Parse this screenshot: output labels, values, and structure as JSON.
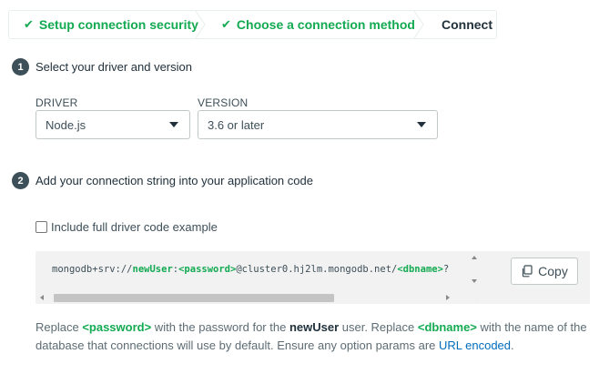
{
  "stepper": {
    "steps": [
      {
        "label": "Setup connection security",
        "state": "done"
      },
      {
        "label": "Choose a connection method",
        "state": "done"
      },
      {
        "label": "Connect",
        "state": "current"
      }
    ]
  },
  "section1": {
    "number": "1",
    "title": "Select your driver and version",
    "driver_label": "DRIVER",
    "driver_value": "Node.js",
    "version_label": "VERSION",
    "version_value": "3.6 or later"
  },
  "section2": {
    "number": "2",
    "title": "Add your connection string into your application code",
    "checkbox_label": "Include full driver code example",
    "connection_string": {
      "prefix": "mongodb+srv://",
      "user": "newUser",
      "colon": ":",
      "password": "<password>",
      "host": "@cluster0.hj2lm.mongodb.net/",
      "dbname": "<dbname>",
      "suffix": "?"
    },
    "copy_label": "Copy"
  },
  "help": {
    "t1": "Replace ",
    "password": "<password>",
    "t2": " with the password for the ",
    "user": "newUser",
    "t3": " user. Replace ",
    "dbname": "<dbname>",
    "t4": " with the name of the database that connections will use by default. Ensure any option params are ",
    "link": "URL encoded",
    "t5": "."
  },
  "colors": {
    "success_green": "#13aa52",
    "text_dark": "#21313c",
    "link_blue": "#006cbc"
  }
}
